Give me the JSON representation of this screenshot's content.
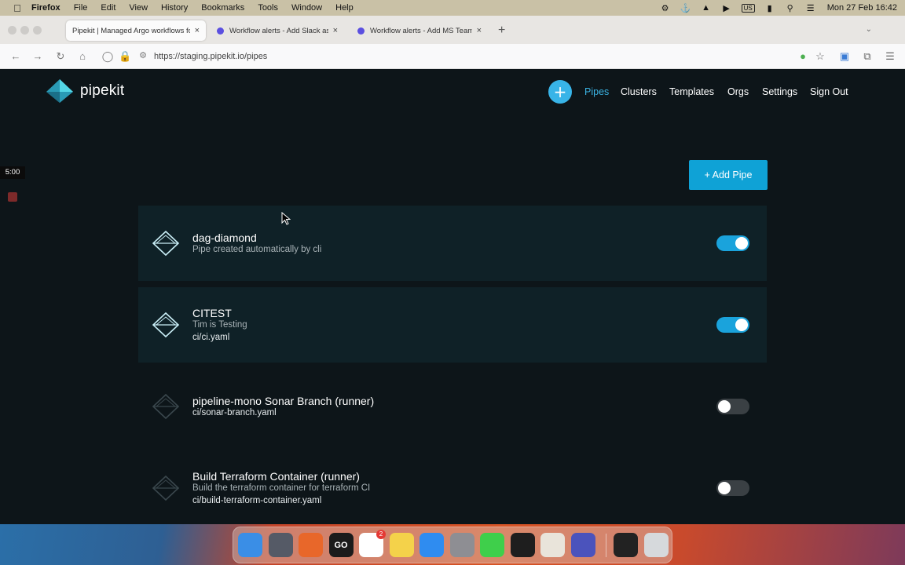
{
  "menubar": {
    "app": "Firefox",
    "items": [
      "File",
      "Edit",
      "View",
      "History",
      "Bookmarks",
      "Tools",
      "Window",
      "Help"
    ],
    "input_source": "US",
    "clock": "Mon 27 Feb  16:42"
  },
  "tabs": [
    {
      "title": "Pipekit | Managed Argo workflows fo",
      "active": true
    },
    {
      "title": "Workflow alerts - Add Slack as a",
      "active": false
    },
    {
      "title": "Workflow alerts - Add MS Teams",
      "active": false
    }
  ],
  "url": "https://staging.pipekit.io/pipes",
  "brand": {
    "name": "pipekit",
    "accent": "#3bb3e3",
    "logo_color": "#3bc0d8"
  },
  "nav": {
    "plus": "+",
    "items": [
      "Pipes",
      "Clusters",
      "Templates",
      "Orgs",
      "Settings",
      "Sign Out"
    ],
    "active": "Pipes"
  },
  "add_pipe_label": "+ Add Pipe",
  "recorder": {
    "time": "5:00"
  },
  "pipes": [
    {
      "name": "dag-diamond",
      "description": "Pipe created automatically by cli",
      "file": "",
      "enabled": true
    },
    {
      "name": "CITEST",
      "description": "Tim is Testing",
      "file": "ci/ci.yaml",
      "enabled": true
    },
    {
      "name": "pipeline-mono Sonar Branch (runner)",
      "description": "",
      "file": "ci/sonar-branch.yaml",
      "enabled": false
    },
    {
      "name": "Build Terraform Container (runner)",
      "description": "Build the terraform container for terraform CI",
      "file": "ci/build-terraform-container.yaml",
      "enabled": false
    }
  ],
  "dock": {
    "apps": [
      {
        "name": "finder-icon",
        "color": "#3a8ee6",
        "glyph": ""
      },
      {
        "name": "launchpad-icon",
        "color": "#555a66",
        "glyph": ""
      },
      {
        "name": "firefox-icon",
        "color": "#e8672a",
        "glyph": ""
      },
      {
        "name": "goland-icon",
        "color": "#1b1b1b",
        "glyph": "GO"
      },
      {
        "name": "slack-icon",
        "color": "#ffffff",
        "glyph": "",
        "badge": "2"
      },
      {
        "name": "notes-icon",
        "color": "#f4d24a",
        "glyph": ""
      },
      {
        "name": "app-store-icon",
        "color": "#2f8cf0",
        "glyph": ""
      },
      {
        "name": "system-settings-icon",
        "color": "#8e8e93",
        "glyph": ""
      },
      {
        "name": "messages-icon",
        "color": "#3fcf4b",
        "glyph": ""
      },
      {
        "name": "terminal-icon",
        "color": "#1e1e1e",
        "glyph": ""
      },
      {
        "name": "keychain-icon",
        "color": "#e9e4da",
        "glyph": ""
      },
      {
        "name": "teams-icon",
        "color": "#4b53bc",
        "glyph": ""
      },
      {
        "name": "activity-monitor-icon",
        "color": "#222222",
        "glyph": ""
      },
      {
        "name": "trash-icon",
        "color": "#d6d9dc",
        "glyph": ""
      }
    ]
  }
}
